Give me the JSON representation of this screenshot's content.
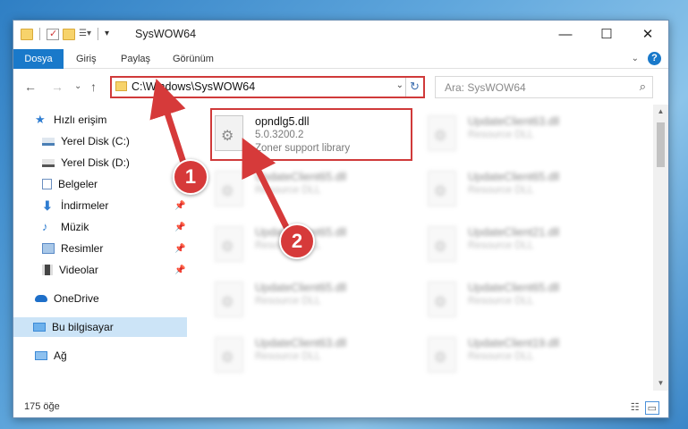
{
  "window": {
    "title": "SysWOW64"
  },
  "window_controls": {
    "minimize": "—",
    "maximize": "☐",
    "close": "✕"
  },
  "ribbon": {
    "tabs": [
      "Dosya",
      "Giriş",
      "Paylaş",
      "Görünüm"
    ],
    "help": "?"
  },
  "address": {
    "path": "C:\\Windows\\SysWOW64",
    "dropdown": "⌄",
    "refresh": "↻"
  },
  "search": {
    "placeholder": "Ara: SysWOW64",
    "icon": "search-icon"
  },
  "nav": {
    "back": "←",
    "forward": "→",
    "recent": "⌄",
    "up": "↑",
    "items": [
      {
        "label": "Hızlı erişim",
        "icon": "star-icon",
        "color": "#2f7dd1"
      },
      {
        "label": "Yerel Disk (C:)",
        "icon": "drive-icon",
        "color": "#4a7fb5"
      },
      {
        "label": "Yerel Disk (D:)",
        "icon": "drive-icon",
        "color": "#555555"
      },
      {
        "label": "Belgeler",
        "icon": "documents-icon",
        "color": "#6b8fc0"
      },
      {
        "label": "İndirmeler",
        "icon": "download-icon",
        "color": "#2f7dd1"
      },
      {
        "label": "Müzik",
        "icon": "music-icon",
        "color": "#2f7dd1"
      },
      {
        "label": "Resimler",
        "icon": "pictures-icon",
        "color": "#5a8ac6"
      },
      {
        "label": "Videolar",
        "icon": "videos-icon",
        "color": "#444444"
      },
      {
        "label": "OneDrive",
        "icon": "cloud-icon",
        "color": "#1e6fc9"
      },
      {
        "label": "Bu bilgisayar",
        "icon": "computer-icon",
        "color": "#3c8ad6"
      },
      {
        "label": "Ağ",
        "icon": "network-icon",
        "color": "#3c8ad6"
      }
    ]
  },
  "files": {
    "highlighted": {
      "name": "opndlg5.dll",
      "version": "5.0.3200.2",
      "description": "Zoner support library"
    },
    "blurred": [
      {
        "name": "UpdateClient63.dll",
        "description": "Resource DLL"
      },
      {
        "name": "UpdateClient65.dll",
        "description": "Resource DLL"
      },
      {
        "name": "UpdateClient65.dll",
        "description": "Resource DLL"
      },
      {
        "name": "UpdateClient65.dll",
        "description": "Resource DLL"
      },
      {
        "name": "UpdateClient21.dll",
        "description": "Resource DLL"
      },
      {
        "name": "UpdateClient65.dll",
        "description": "Resource DLL"
      },
      {
        "name": "UpdateClient65.dll",
        "description": "Resource DLL"
      },
      {
        "name": "UpdateClient63.dll",
        "description": "Resource DLL"
      },
      {
        "name": "UpdateClient19.dll",
        "description": "Resource DLL"
      }
    ]
  },
  "status": {
    "count": "175 öğe"
  },
  "callouts": {
    "one": "1",
    "two": "2",
    "color": "#d63a3a"
  }
}
